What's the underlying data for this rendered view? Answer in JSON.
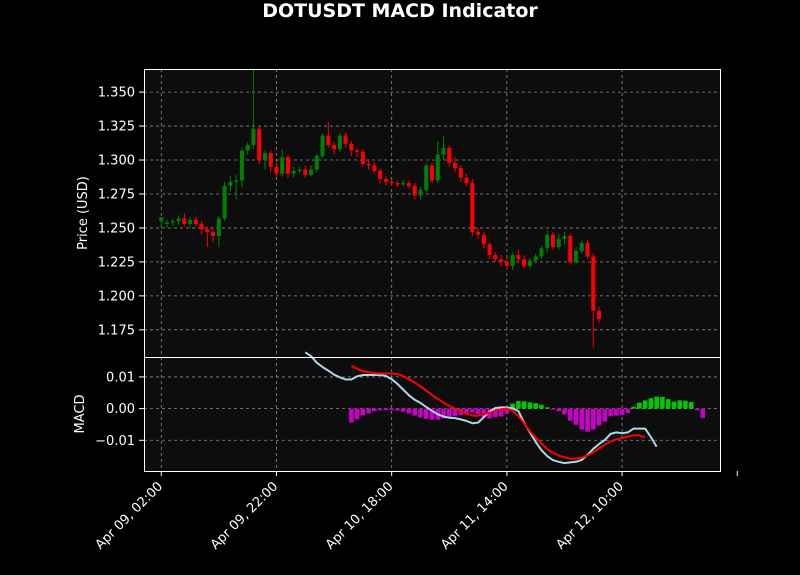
{
  "title": "DOTUSDT MACD Indicator",
  "colors": {
    "background": "#000000",
    "plot_background": "#0d0d0d",
    "up_candle": "#008000",
    "down_candle": "#ff0000",
    "macd_line": "#add8e6",
    "signal_line": "#ff0000",
    "hist_positive": "#00c800",
    "hist_negative": "#c800c8",
    "grid": "#8c8c8c"
  },
  "chart_data": [
    {
      "type": "candlestick",
      "ylabel": "Price (USD)",
      "ylim": [
        1.155,
        1.367
      ],
      "yticks": [
        "1.175",
        "1.200",
        "1.225",
        "1.250",
        "1.275",
        "1.300",
        "1.325",
        "1.350"
      ],
      "grid": true,
      "x_index_range": [
        -3,
        97
      ],
      "candles": [
        [
          1.255,
          1.258,
          1.258,
          1.251
        ],
        [
          1.253,
          1.254,
          1.256,
          1.25
        ],
        [
          1.254,
          1.255,
          1.257,
          1.251
        ],
        [
          1.255,
          1.257,
          1.259,
          1.252
        ],
        [
          1.257,
          1.253,
          1.261,
          1.251
        ],
        [
          1.253,
          1.256,
          1.258,
          1.25
        ],
        [
          1.256,
          1.253,
          1.258,
          1.251
        ],
        [
          1.253,
          1.249,
          1.255,
          1.245
        ],
        [
          1.249,
          1.247,
          1.251,
          1.236
        ],
        [
          1.247,
          1.244,
          1.25,
          1.24
        ],
        [
          1.244,
          1.257,
          1.259,
          1.236
        ],
        [
          1.257,
          1.281,
          1.284,
          1.255
        ],
        [
          1.281,
          1.284,
          1.288,
          1.277
        ],
        [
          1.284,
          1.285,
          1.289,
          1.271
        ],
        [
          1.285,
          1.307,
          1.309,
          1.28
        ],
        [
          1.307,
          1.311,
          1.313,
          1.304
        ],
        [
          1.311,
          1.323,
          1.367,
          1.308
        ],
        [
          1.323,
          1.3,
          1.325,
          1.297
        ],
        [
          1.3,
          1.305,
          1.307,
          1.293
        ],
        [
          1.305,
          1.295,
          1.307,
          1.291
        ],
        [
          1.295,
          1.29,
          1.298,
          1.287
        ],
        [
          1.29,
          1.302,
          1.308,
          1.288
        ],
        [
          1.302,
          1.29,
          1.304,
          1.287
        ],
        [
          1.29,
          1.292,
          1.295,
          1.287
        ],
        [
          1.292,
          1.293,
          1.295,
          1.29
        ],
        [
          1.293,
          1.289,
          1.296,
          1.287
        ],
        [
          1.289,
          1.293,
          1.296,
          1.288
        ],
        [
          1.293,
          1.303,
          1.305,
          1.291
        ],
        [
          1.303,
          1.318,
          1.32,
          1.301
        ],
        [
          1.318,
          1.311,
          1.328,
          1.309
        ],
        [
          1.311,
          1.308,
          1.313,
          1.304
        ],
        [
          1.308,
          1.318,
          1.32,
          1.306
        ],
        [
          1.318,
          1.312,
          1.32,
          1.309
        ],
        [
          1.312,
          1.307,
          1.314,
          1.303
        ],
        [
          1.307,
          1.306,
          1.309,
          1.302
        ],
        [
          1.306,
          1.297,
          1.308,
          1.295
        ],
        [
          1.297,
          1.296,
          1.3,
          1.293
        ],
        [
          1.296,
          1.292,
          1.298,
          1.29
        ],
        [
          1.292,
          1.286,
          1.294,
          1.283
        ],
        [
          1.286,
          1.284,
          1.288,
          1.281
        ],
        [
          1.284,
          1.283,
          1.286,
          1.281
        ],
        [
          1.283,
          1.282,
          1.285,
          1.28
        ],
        [
          1.282,
          1.283,
          1.285,
          1.281
        ],
        [
          1.283,
          1.281,
          1.285,
          1.279
        ],
        [
          1.281,
          1.274,
          1.283,
          1.271
        ],
        [
          1.274,
          1.278,
          1.28,
          1.271
        ],
        [
          1.278,
          1.296,
          1.298,
          1.276
        ],
        [
          1.296,
          1.285,
          1.298,
          1.283
        ],
        [
          1.285,
          1.304,
          1.314,
          1.283
        ],
        [
          1.304,
          1.309,
          1.318,
          1.3
        ],
        [
          1.309,
          1.298,
          1.311,
          1.295
        ],
        [
          1.298,
          1.294,
          1.302,
          1.291
        ],
        [
          1.294,
          1.287,
          1.296,
          1.284
        ],
        [
          1.287,
          1.283,
          1.29,
          1.281
        ],
        [
          1.283,
          1.247,
          1.286,
          1.244
        ],
        [
          1.247,
          1.245,
          1.25,
          1.242
        ],
        [
          1.245,
          1.238,
          1.247,
          1.235
        ],
        [
          1.238,
          1.23,
          1.24,
          1.227
        ],
        [
          1.23,
          1.227,
          1.232,
          1.225
        ],
        [
          1.227,
          1.225,
          1.23,
          1.222
        ],
        [
          1.225,
          1.222,
          1.228,
          1.219
        ],
        [
          1.222,
          1.23,
          1.232,
          1.219
        ],
        [
          1.23,
          1.227,
          1.234,
          1.224
        ],
        [
          1.227,
          1.222,
          1.23,
          1.22
        ],
        [
          1.222,
          1.226,
          1.228,
          1.22
        ],
        [
          1.226,
          1.229,
          1.231,
          1.224
        ],
        [
          1.229,
          1.235,
          1.237,
          1.227
        ],
        [
          1.235,
          1.245,
          1.248,
          1.232
        ],
        [
          1.245,
          1.236,
          1.247,
          1.234
        ],
        [
          1.236,
          1.242,
          1.246,
          1.234
        ],
        [
          1.242,
          1.244,
          1.247,
          1.238
        ],
        [
          1.244,
          1.225,
          1.246,
          1.223
        ],
        [
          1.225,
          1.233,
          1.236,
          1.223
        ],
        [
          1.233,
          1.239,
          1.241,
          1.231
        ],
        [
          1.239,
          1.229,
          1.241,
          1.227
        ],
        [
          1.229,
          1.189,
          1.231,
          1.162
        ],
        [
          1.189,
          1.183,
          1.192,
          1.18
        ]
      ]
    },
    {
      "type": "line+bar",
      "ylabel": "MACD",
      "ylim": [
        -0.0197,
        0.0163
      ],
      "yticks": [
        "−0.01",
        "0.00",
        "0.01"
      ],
      "grid": true,
      "x_index_range": [
        -3,
        97
      ],
      "xticks": [
        {
          "index": 0,
          "label": "Apr 09, 02:00"
        },
        {
          "index": 20,
          "label": "Apr 09, 22:00"
        },
        {
          "index": 40,
          "label": "Apr 10, 18:00"
        },
        {
          "index": 60,
          "label": "Apr 11, 14:00"
        },
        {
          "index": 80,
          "label": "Apr 12, 10:00"
        },
        {
          "index": 100,
          "label": ""
        }
      ],
      "series": [
        {
          "name": "",
          "role": "macd",
          "start_index": 25,
          "values": [
            0.0178,
            0.0166,
            0.0145,
            0.0131,
            0.012,
            0.0107,
            0.0099,
            0.0092,
            0.0092,
            0.0102,
            0.0106,
            0.0106,
            0.0106,
            0.0106,
            0.0103,
            0.0093,
            0.0078,
            0.006,
            0.0042,
            0.0028,
            0.0018,
            0.0005,
            -0.0007,
            -0.0018,
            -0.0025,
            -0.0029,
            -0.003,
            -0.0034,
            -0.0039,
            -0.0046,
            -0.0044,
            -0.0027,
            -0.0009,
            0.0002,
            0.0004,
            0.0004,
            0.0001,
            -0.0008,
            -0.0045,
            -0.0075,
            -0.0105,
            -0.0131,
            -0.015,
            -0.0163,
            -0.0168,
            -0.0172,
            -0.017,
            -0.0168,
            -0.0162,
            -0.0146,
            -0.0127,
            -0.0112,
            -0.0099,
            -0.008,
            -0.0075,
            -0.0078,
            -0.0075,
            -0.0063,
            -0.0063,
            -0.0063,
            -0.009,
            -0.012
          ]
        },
        {
          "name": "",
          "role": "signal",
          "start_index": 33,
          "values": [
            0.0135,
            0.0126,
            0.0118,
            0.0115,
            0.0112,
            0.0111,
            0.0111,
            0.0111,
            0.0109,
            0.0103,
            0.0093,
            0.0082,
            0.007,
            0.0057,
            0.0043,
            0.0031,
            0.0019,
            0.0009,
            -0.0001,
            -0.0009,
            -0.0016,
            -0.0022,
            -0.0022,
            -0.0018,
            -0.0013,
            -0.0007,
            -0.0002,
            0.0,
            -0.0007,
            -0.0024,
            -0.0047,
            -0.0071,
            -0.0092,
            -0.011,
            -0.0127,
            -0.014,
            -0.0148,
            -0.0154,
            -0.0158,
            -0.0158,
            -0.0155,
            -0.0148,
            -0.0138,
            -0.0126,
            -0.0114,
            -0.0104,
            -0.0097,
            -0.0093,
            -0.0088,
            -0.0084,
            -0.0085,
            -0.0091
          ]
        },
        {
          "name": "",
          "role": "histogram",
          "start_index": 33,
          "values": [
            -0.0044,
            -0.0034,
            -0.0021,
            -0.0015,
            -0.0008,
            -0.0005,
            -0.0005,
            -0.0005,
            -0.0006,
            -0.001,
            -0.0015,
            -0.0022,
            -0.0028,
            -0.0032,
            -0.0035,
            -0.0035,
            -0.0031,
            -0.0028,
            -0.0024,
            -0.002,
            -0.0014,
            -0.0012,
            -0.0017,
            -0.0028,
            -0.0031,
            -0.0027,
            -0.0025,
            -0.0015,
            0.0016,
            0.0024,
            0.0023,
            0.002,
            0.0017,
            0.0012,
            0.0004,
            -0.0003,
            -0.0008,
            -0.0018,
            -0.0038,
            -0.0051,
            -0.0066,
            -0.0073,
            -0.0066,
            -0.0053,
            -0.0041,
            -0.0024,
            -0.0022,
            -0.002,
            -0.0014,
            0.0006,
            0.0019,
            0.0026,
            0.0033,
            0.0038,
            0.0037,
            0.003,
            0.0022,
            0.0026,
            0.0025,
            0.0021,
            -0.0005,
            -0.0029
          ]
        }
      ]
    }
  ]
}
